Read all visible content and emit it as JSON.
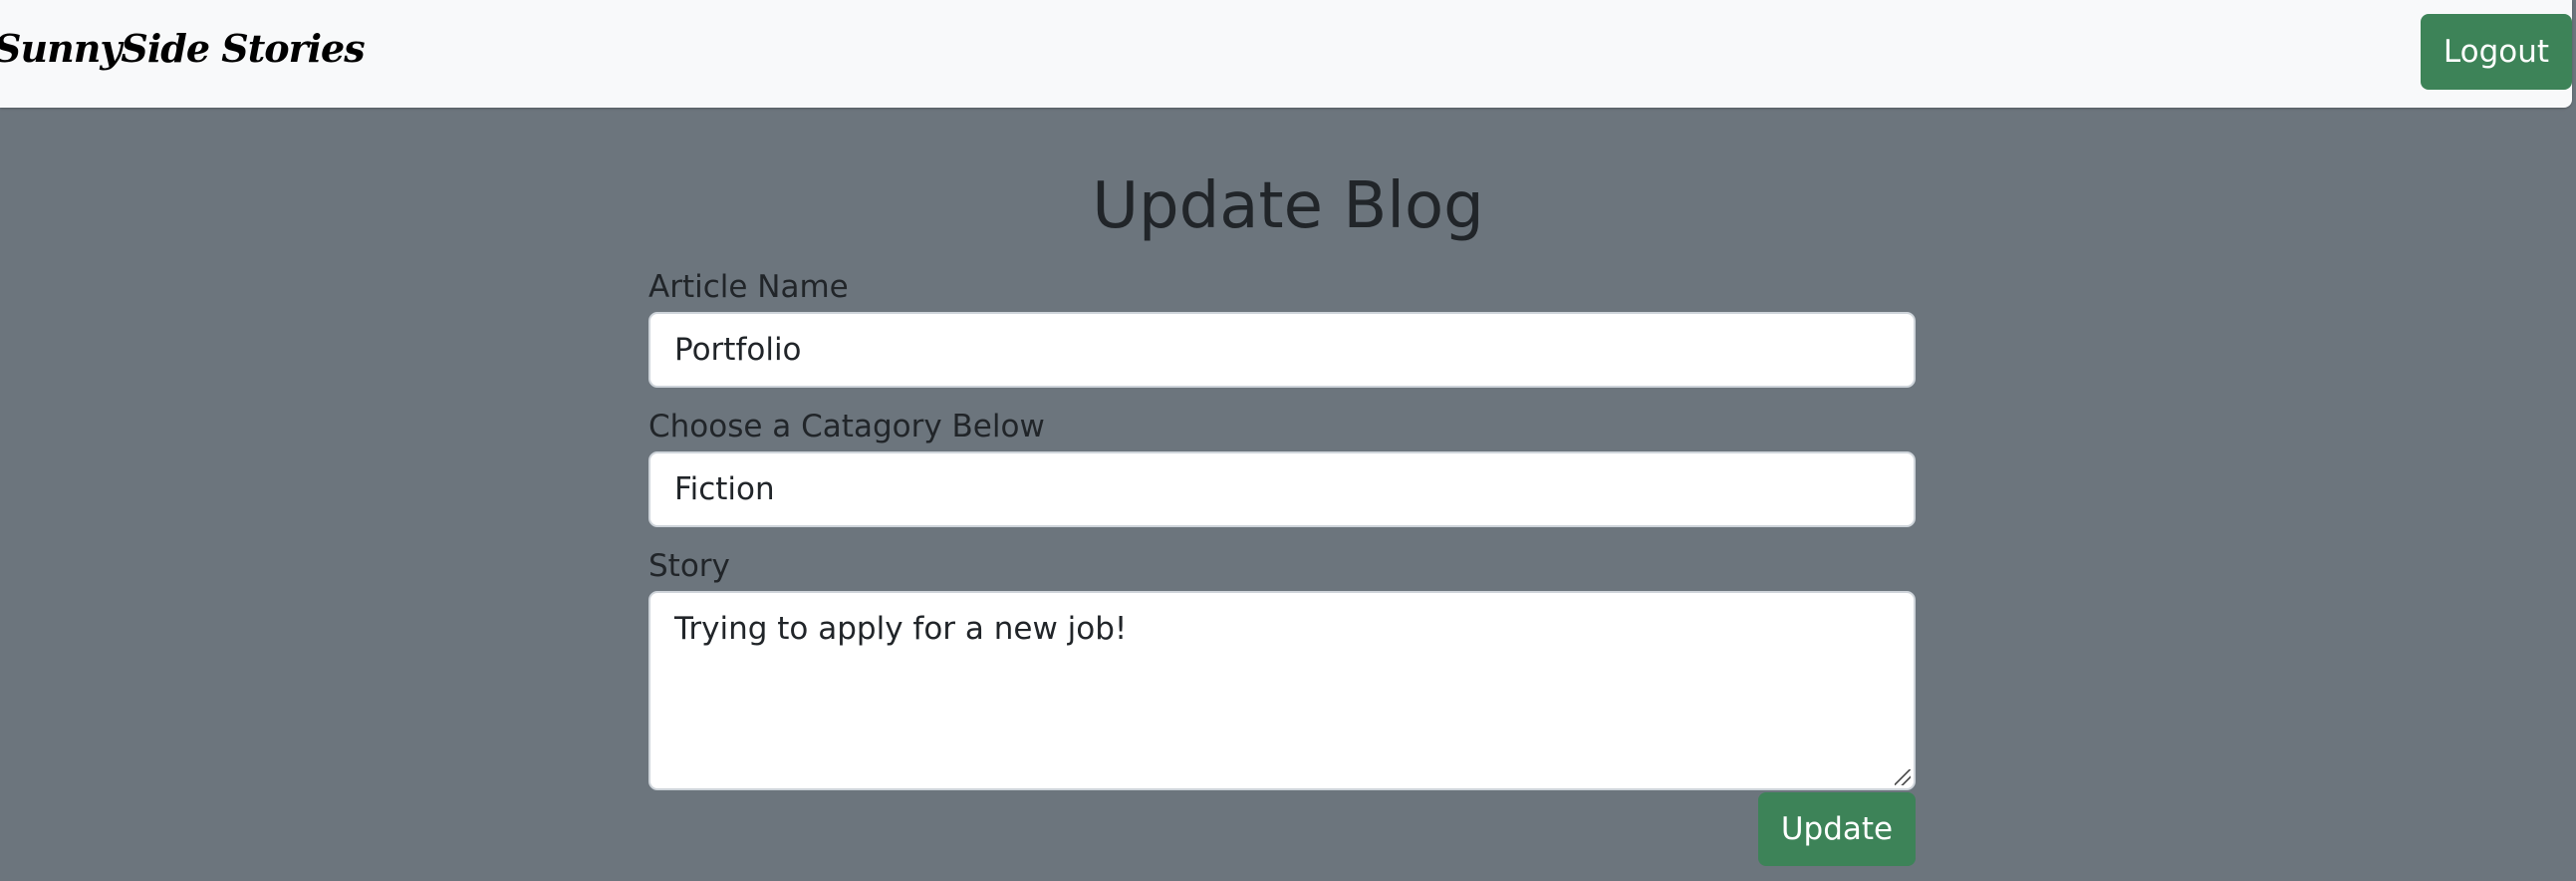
{
  "navbar": {
    "brand": "SunnySide Stories",
    "logout_label": "Logout"
  },
  "page": {
    "title": "Update Blog"
  },
  "form": {
    "article_name": {
      "label": "Article Name",
      "value": "Portfolio"
    },
    "category": {
      "label": "Choose a Catagory Below",
      "value": "Fiction"
    },
    "story": {
      "label": "Story",
      "value": "Trying to apply for a new job!"
    },
    "update_label": "Update"
  },
  "colors": {
    "background": "#6c757d",
    "navbar": "#f8f9fa",
    "button_green": "#3d8358"
  }
}
